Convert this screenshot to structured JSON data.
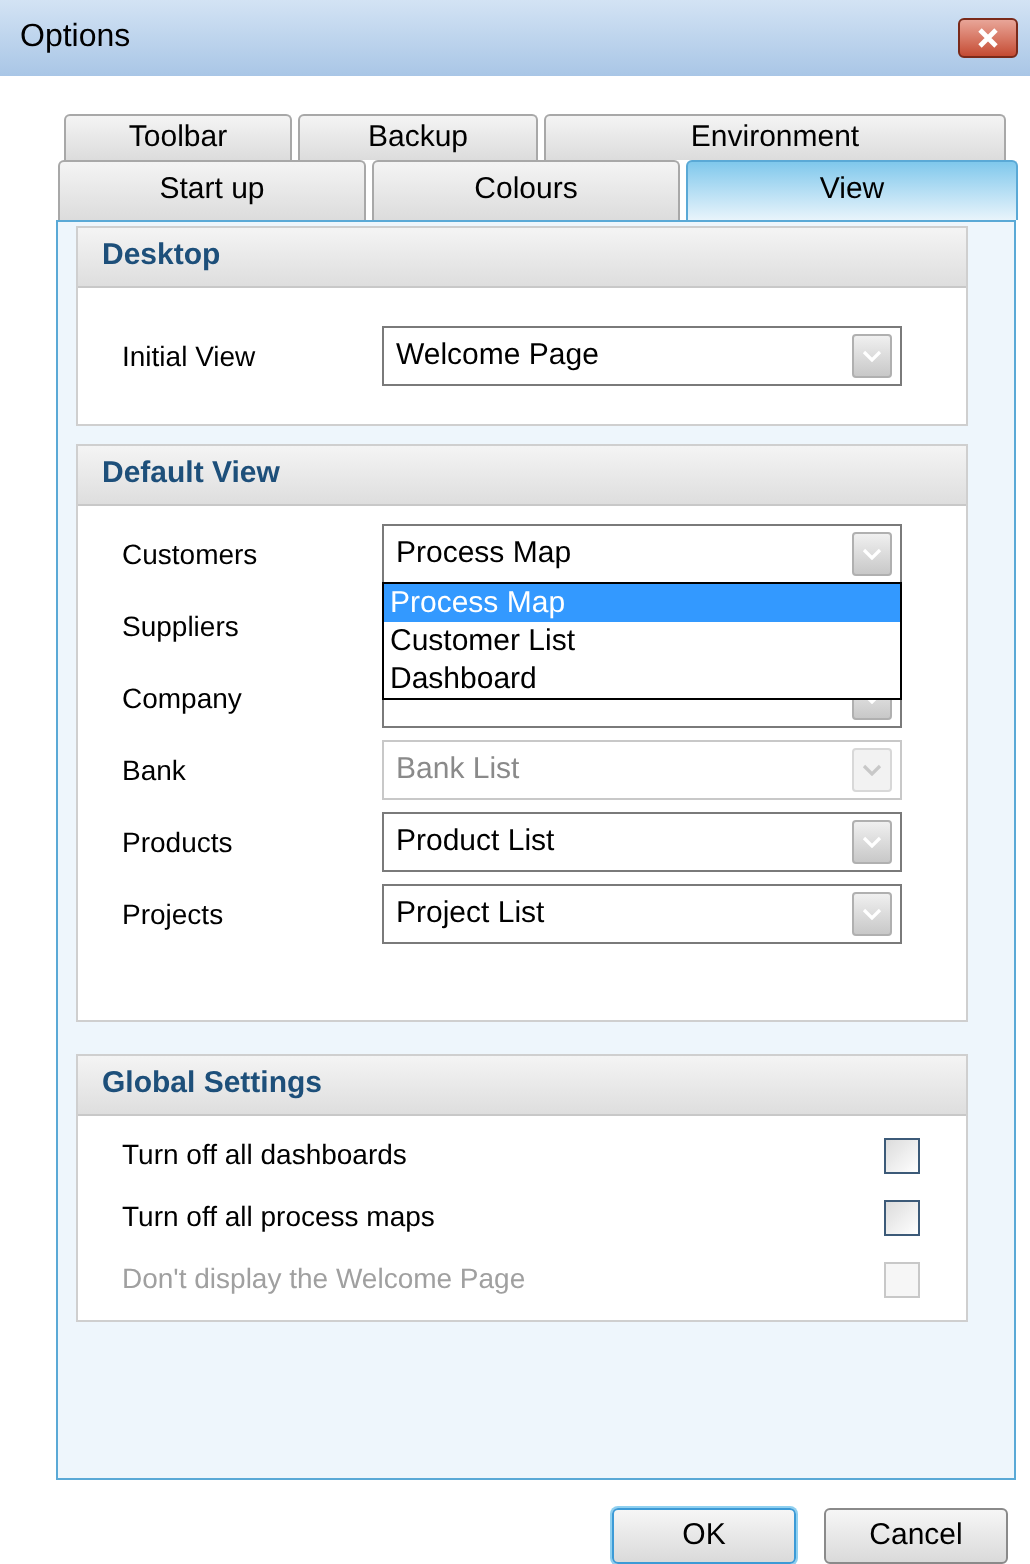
{
  "window": {
    "title": "Options"
  },
  "tab_rows": [
    [
      {
        "label": "Toolbar",
        "selected": false
      },
      {
        "label": "Backup",
        "selected": false
      },
      {
        "label": "Environment",
        "selected": false
      }
    ],
    [
      {
        "label": "Start up",
        "selected": false
      },
      {
        "label": "Colours",
        "selected": false
      },
      {
        "label": "View",
        "selected": true
      }
    ]
  ],
  "desktop": {
    "title": "Desktop",
    "fields": [
      {
        "label": "Initial View",
        "value": "Welcome Page",
        "disabled": false
      }
    ]
  },
  "default_view": {
    "title": "Default View",
    "fields": [
      {
        "label": "Customers",
        "value": "Process Map",
        "disabled": false,
        "options": [
          {
            "label": "Process Map",
            "selected": true
          },
          {
            "label": "Customer List",
            "selected": false
          },
          {
            "label": "Dashboard",
            "selected": false
          }
        ]
      },
      {
        "label": "Suppliers"
      },
      {
        "label": "Company"
      },
      {
        "label": "Bank",
        "value": "Bank List",
        "disabled": true
      },
      {
        "label": "Products",
        "value": "Product List",
        "disabled": false
      },
      {
        "label": "Projects",
        "value": "Project List",
        "disabled": false
      }
    ]
  },
  "global_settings": {
    "title": "Global Settings",
    "options": [
      {
        "label": "Turn off all dashboards",
        "checked": false,
        "disabled": false
      },
      {
        "label": "Turn off all process maps",
        "checked": false,
        "disabled": false
      },
      {
        "label": "Don't display the Welcome Page",
        "checked": false,
        "disabled": true
      }
    ]
  },
  "buttons": [
    {
      "label": "OK",
      "default": true
    },
    {
      "label": "Cancel",
      "default": false
    }
  ]
}
